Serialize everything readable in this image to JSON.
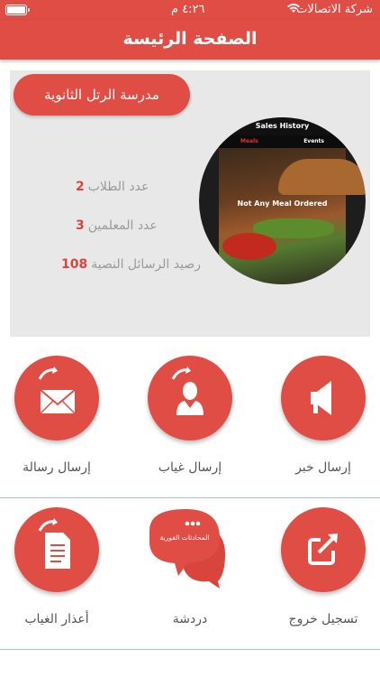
{
  "status_bar": {
    "carrier": "شركة الاتصالات",
    "time": "٤:٢٦ م",
    "battery_level": 1.0
  },
  "nav": {
    "title": "الصفحة الرئيسة"
  },
  "school": {
    "name": "مدرسة الرتل الثانوية",
    "stats": [
      {
        "label": "عدد الطلاب",
        "value": "2"
      },
      {
        "label": "عدد المعلمين",
        "value": "3"
      },
      {
        "label": "رصيد الرسائل النصية",
        "value": "108"
      }
    ]
  },
  "embedded_screen": {
    "title": "Sales History",
    "tab_meals": "Meals",
    "tab_events": "Events",
    "empty_message": "Not Any Meal Ordered"
  },
  "actions_row1": [
    {
      "label": "إرسال خبر",
      "icon": "megaphone-icon"
    },
    {
      "label": "إرسال غياب",
      "icon": "person-send-icon"
    },
    {
      "label": "إرسال رسالة",
      "icon": "envelope-send-icon"
    }
  ],
  "actions_row2": [
    {
      "label": "تسجيل خروج",
      "icon": "logout-icon"
    },
    {
      "label": "دردشة",
      "icon": "chat-bubbles-icon",
      "bubble_text": "المحادثات الفورية"
    },
    {
      "label": "أعذار الغياب",
      "icon": "document-send-icon"
    }
  ],
  "colors": {
    "accent": "#e04d45",
    "card_bg": "#e8e8e8",
    "number": "#d9443c",
    "divider": "#9cc7cc"
  }
}
